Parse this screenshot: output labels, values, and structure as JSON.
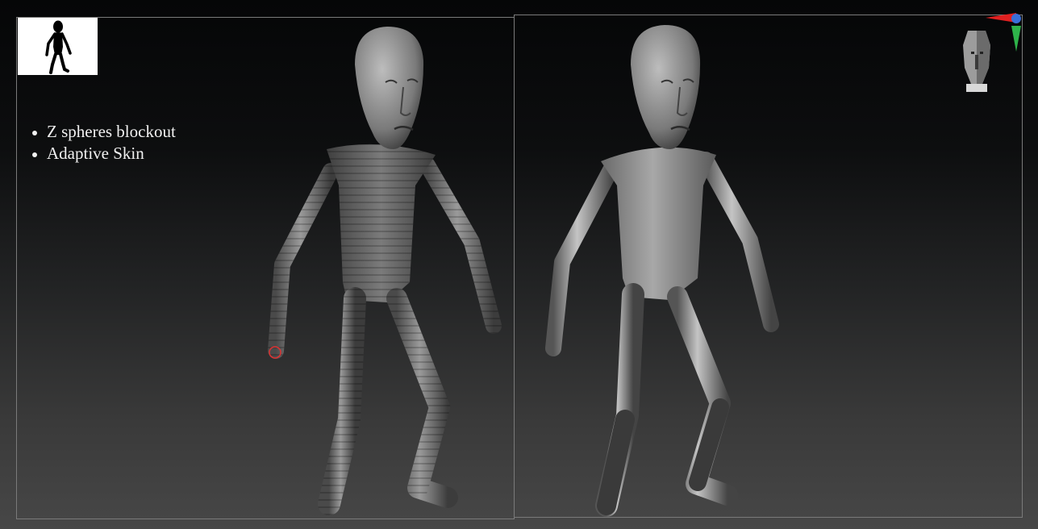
{
  "bullets": [
    "Z spheres blockout",
    "Adaptive Skin"
  ],
  "icons": {
    "thumbnail": "figure-silhouette-icon",
    "nav_head": "navigation-head-icon",
    "axis_gizmo": "axis-gizmo-icon"
  },
  "colors": {
    "background_top": "#050607",
    "background_bottom": "#474747",
    "viewport_border": "#7a7a7a",
    "text": "#f1f1f1",
    "axis_x": "#e02020",
    "axis_y": "#2eb34a",
    "axis_z": "#3a6fd8"
  }
}
